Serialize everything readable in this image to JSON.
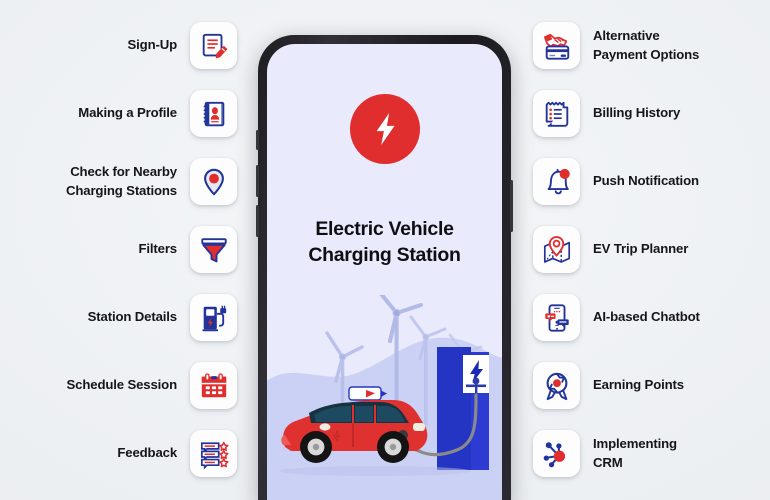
{
  "page": {
    "background_color": "#eceff2",
    "accent_red": "#e02e2e",
    "accent_blue": "#22349a",
    "card_color": "#fdfdfd"
  },
  "phone": {
    "screen_color": "#e9eafb",
    "logo_icon": "lightning-bolt-icon",
    "app_title": "Electric Vehicle\nCharging Station",
    "illustration": {
      "name": "ev-charging-illustration",
      "elements": [
        "red-electric-car",
        "blue-charging-station",
        "wind-turbines",
        "battery-indicator",
        "charging-cable"
      ]
    }
  },
  "left_features": [
    {
      "label": "Sign-Up",
      "icon": "signup-document-pencil-icon"
    },
    {
      "label": "Making a Profile",
      "icon": "profile-notebook-icon"
    },
    {
      "label": "Check for Nearby\nCharging Stations",
      "icon": "map-pin-icon"
    },
    {
      "label": "Filters",
      "icon": "filter-funnel-icon"
    },
    {
      "label": "Station Details",
      "icon": "charging-pump-icon"
    },
    {
      "label": "Schedule Session",
      "icon": "calendar-icon"
    },
    {
      "label": "Feedback",
      "icon": "feedback-stars-icon"
    }
  ],
  "right_features": [
    {
      "label": "Alternative\nPayment Options",
      "icon": "handshake-credit-card-icon"
    },
    {
      "label": "Billing History",
      "icon": "receipt-bill-icon"
    },
    {
      "label": "Push Notification",
      "icon": "bell-notification-icon"
    },
    {
      "label": "EV Trip Planner",
      "icon": "map-route-pin-icon"
    },
    {
      "label": "AI-based Chatbot",
      "icon": "chatbot-phone-icon"
    },
    {
      "label": "Earning Points",
      "icon": "award-rosette-icon"
    },
    {
      "label": "Implementing\nCRM",
      "icon": "crm-network-nodes-icon"
    }
  ]
}
